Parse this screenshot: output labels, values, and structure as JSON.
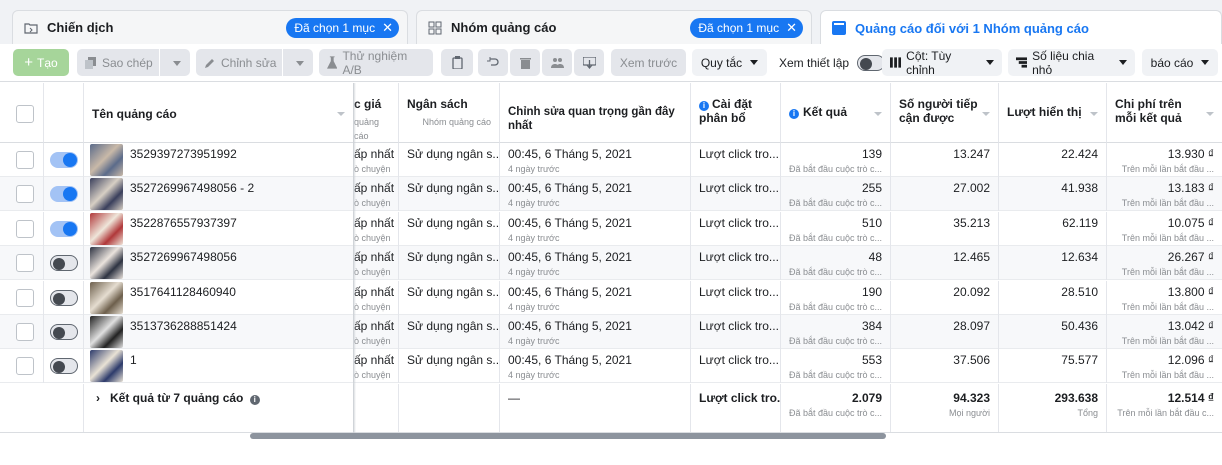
{
  "tabs": {
    "campaign": {
      "label": "Chiến dịch",
      "pill": "Đã chọn 1 mục"
    },
    "adset": {
      "label": "Nhóm quảng cáo",
      "pill": "Đã chọn 1 mục"
    },
    "ads": {
      "label": "Quảng cáo đối với 1 Nhóm quảng cáo"
    }
  },
  "toolbar": {
    "create": "Tạo",
    "duplicate": "Sao chép",
    "edit": "Chỉnh sửa",
    "ab_test": "Thử nghiệm A/B",
    "preview": "Xem trước",
    "rules": "Quy tắc",
    "view_setup": "Xem thiết lập",
    "columns": "Cột: Tùy chỉnh",
    "breakdown": "Số liệu chia nhỏ",
    "reports": "báo cáo"
  },
  "columns": {
    "name": "Tên quảng cáo",
    "bid": "c giá",
    "bid_sub": "quảng cáo",
    "budget": "Ngân sách",
    "budget_sub": "Nhóm quảng cáo",
    "recent_edit": "Chỉnh sửa quan trọng gần đây nhất",
    "attribution": "Cài đặt phân bổ",
    "results": "Kết quả",
    "reach": "Số người tiếp cận được",
    "impressions": "Lượt hiển thị",
    "cost_per_result": "Chi phí trên mỗi kết quả"
  },
  "rows": [
    {
      "name": "3529397273951992",
      "on": true,
      "bid": "ấp nhất",
      "bid_sub": "ò chuyện",
      "budget": "Sử dụng ngân s...",
      "edit": "00:45, 6 Tháng 5, 2021",
      "edit_sub": "4 ngày trước",
      "attr": "Lượt click tro...",
      "results": "139",
      "results_sub": "Đã bắt đầu cuộc trò c...",
      "reach": "13.247",
      "impressions": "22.424",
      "cost": "13.930 ₫",
      "cost_sub": "Trên mỗi lần bắt đầu ..."
    },
    {
      "name": "3527269967498056 - 2",
      "on": true,
      "bid": "ấp nhất",
      "bid_sub": "ò chuyện",
      "budget": "Sử dụng ngân s...",
      "edit": "00:45, 6 Tháng 5, 2021",
      "edit_sub": "4 ngày trước",
      "attr": "Lượt click tro...",
      "results": "255",
      "results_sub": "Đã bắt đầu cuộc trò c...",
      "reach": "27.002",
      "impressions": "41.938",
      "cost": "13.183 ₫",
      "cost_sub": "Trên mỗi lần bắt đầu ..."
    },
    {
      "name": "3522876557937397",
      "on": true,
      "bid": "ấp nhất",
      "bid_sub": "ò chuyện",
      "budget": "Sử dụng ngân s...",
      "edit": "00:45, 6 Tháng 5, 2021",
      "edit_sub": "4 ngày trước",
      "attr": "Lượt click tro...",
      "results": "510",
      "results_sub": "Đã bắt đầu cuộc trò c...",
      "reach": "35.213",
      "impressions": "62.119",
      "cost": "10.075 ₫",
      "cost_sub": "Trên mỗi lần bắt đầu ..."
    },
    {
      "name": "3527269967498056",
      "on": false,
      "bid": "ấp nhất",
      "bid_sub": "ò chuyện",
      "budget": "Sử dụng ngân s...",
      "edit": "00:45, 6 Tháng 5, 2021",
      "edit_sub": "4 ngày trước",
      "attr": "Lượt click tro...",
      "results": "48",
      "results_sub": "Đã bắt đầu cuộc trò c...",
      "reach": "12.465",
      "impressions": "12.634",
      "cost": "26.267 ₫",
      "cost_sub": "Trên mỗi lần bắt đầu ..."
    },
    {
      "name": "3517641128460940",
      "on": false,
      "bid": "ấp nhất",
      "bid_sub": "ò chuyện",
      "budget": "Sử dụng ngân s...",
      "edit": "00:45, 6 Tháng 5, 2021",
      "edit_sub": "4 ngày trước",
      "attr": "Lượt click tro...",
      "results": "190",
      "results_sub": "Đã bắt đầu cuộc trò c...",
      "reach": "20.092",
      "impressions": "28.510",
      "cost": "13.800 ₫",
      "cost_sub": "Trên mỗi lần bắt đầu ..."
    },
    {
      "name": "3513736288851424",
      "on": false,
      "bid": "ấp nhất",
      "bid_sub": "ò chuyện",
      "budget": "Sử dụng ngân s...",
      "edit": "00:45, 6 Tháng 5, 2021",
      "edit_sub": "4 ngày trước",
      "attr": "Lượt click tro...",
      "results": "384",
      "results_sub": "Đã bắt đầu cuộc trò c...",
      "reach": "28.097",
      "impressions": "50.436",
      "cost": "13.042 ₫",
      "cost_sub": "Trên mỗi lần bắt đầu ..."
    },
    {
      "name": "1",
      "on": false,
      "bid": "ấp nhất",
      "bid_sub": "ò chuyện",
      "budget": "Sử dụng ngân s...",
      "edit": "00:45, 6 Tháng 5, 2021",
      "edit_sub": "4 ngày trước",
      "attr": "Lượt click tro...",
      "results": "553",
      "results_sub": "Đã bắt đầu cuộc trò c...",
      "reach": "37.506",
      "impressions": "75.577",
      "cost": "12.096 ₫",
      "cost_sub": "Trên mỗi lần bắt đầu ..."
    }
  ],
  "summary": {
    "label": "Kết quả từ 7 quảng cáo",
    "edit": "—",
    "attr": "Lượt click tro...",
    "results": "2.079",
    "results_sub": "Đã bắt đầu cuộc trò c...",
    "reach": "94.323",
    "reach_sub": "Mọi người",
    "impressions": "293.638",
    "impressions_sub": "Tổng",
    "cost": "12.514 ₫",
    "cost_sub": "Trên mỗi lần bắt đầu c..."
  },
  "colors": {
    "accent": "#1877f2",
    "create_button": "#a6d59a"
  }
}
